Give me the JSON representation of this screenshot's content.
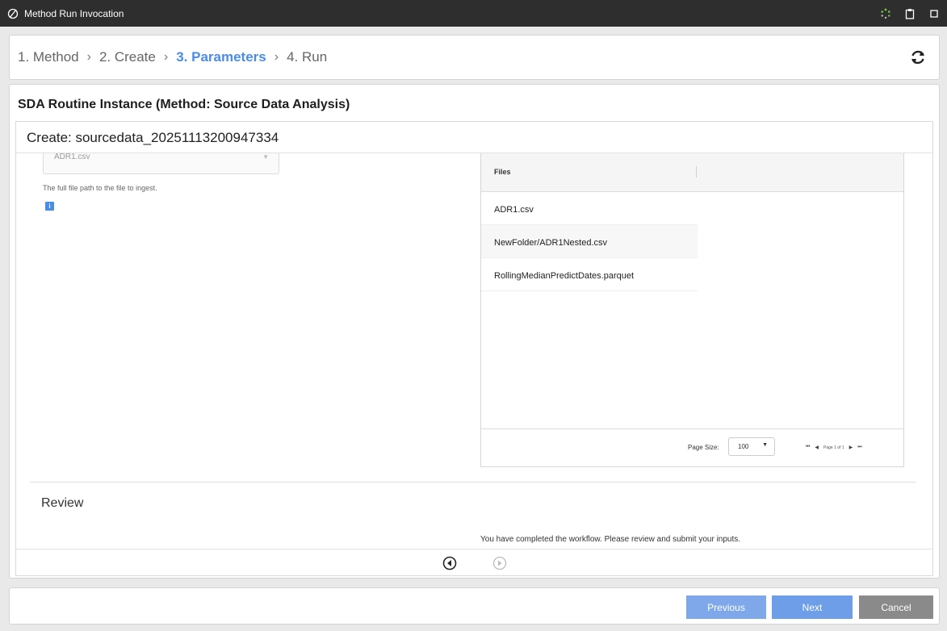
{
  "window": {
    "title": "Method Run Invocation",
    "icons": [
      "method-logo-icon",
      "spinner-icon",
      "clipboard-icon",
      "maximize-icon"
    ]
  },
  "wizard": {
    "steps": [
      {
        "label": "1. Method",
        "active": false
      },
      {
        "label": "2. Create",
        "active": false
      },
      {
        "label": "3. Parameters",
        "active": true
      },
      {
        "label": "4. Run",
        "active": false
      }
    ],
    "separator": "›",
    "refresh_icon": "refresh-icon",
    "accent_color": "#4a8de8"
  },
  "main": {
    "title": "SDA Routine Instance (Method: Source Data Analysis)",
    "panel_title": "Create: sourcedata_20251113200947334"
  },
  "file_field": {
    "value": "ADR1.csv",
    "help_text": "The full file path to the file to ingest.",
    "info_icon": "i"
  },
  "files_grid": {
    "column_header": "Files",
    "rows": [
      "ADR1.csv",
      "NewFolder/ADR1Nested.csv",
      "RollingMedianPredictDates.parquet"
    ],
    "page_size_label": "Page Size:",
    "page_size_value": "100",
    "page_info": "Page 1 of 1"
  },
  "review": {
    "title": "Review",
    "message": "You have completed the workflow. Please review and submit your inputs."
  },
  "footer": {
    "previous_label": "Previous",
    "next_label": "Next",
    "cancel_label": "Cancel"
  }
}
